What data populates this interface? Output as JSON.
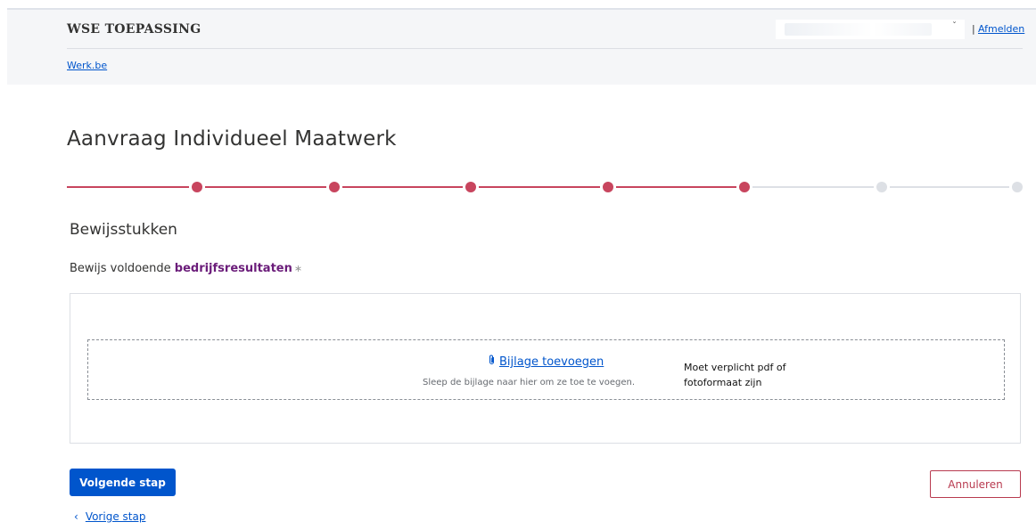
{
  "header": {
    "app_title": "WSE TOEPASSING",
    "logout_separator": "|",
    "logout_label": "Afmelden",
    "home_link": "Werk.be",
    "user_caret": "ˇ"
  },
  "page": {
    "title": "Aanvraag Individueel Maatwerk"
  },
  "progress": {
    "total_steps": 7,
    "completed_steps": 5,
    "done_color": "#c8455e",
    "todo_color": "#dde0e5"
  },
  "section": {
    "title": "Bewijsstukken",
    "field_label_prefix": "Bewijs voldoende ",
    "field_label_term": "bedrijfsresultaten",
    "required_mark": "∗"
  },
  "upload": {
    "attach_icon": "paperclip-icon",
    "attach_label": "Bijlage toevoegen",
    "drop_hint": "Sleep de bijlage naar hier om ze toe te voegen.",
    "format_note": "Moet verplicht pdf of fotoformaat zijn"
  },
  "actions": {
    "next_label": "Volgende stap",
    "cancel_label": "Annuleren",
    "prev_label": "Vorige stap",
    "prev_icon": "chevron-left-icon"
  },
  "colors": {
    "primary": "#0055cc",
    "accent": "#c8455e",
    "term_purple": "#6b1d7a"
  }
}
